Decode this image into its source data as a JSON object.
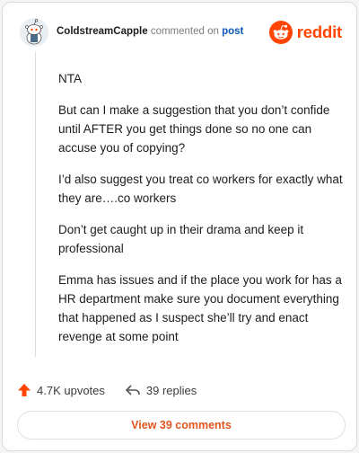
{
  "comment": {
    "username": "ColdstreamCapple",
    "action_text": "commented on",
    "post_link": "post",
    "brand": "reddit",
    "paragraphs": [
      "NTA",
      "But can I make a suggestion that you don’t confide until AFTER you get things done so no one can accuse you of copying?",
      "I’d also suggest you treat co workers for exactly what they are….co workers",
      "Don’t get caught up in their drama and keep it professional",
      "Emma has issues and if the place you work for has a HR department make sure you document everything that happened as I suspect she’ll try and enact revenge at some point"
    ]
  },
  "footer": {
    "upvotes": "4.7K upvotes",
    "replies": "39 replies",
    "view_comments": "View 39 comments"
  },
  "colors": {
    "brand_orange": "#ff4500",
    "link_blue": "#0a58b8",
    "button_text": "#e0561f"
  },
  "icons": [
    "avatar-snoo-icon",
    "reddit-logo-icon",
    "upvote-arrow-icon",
    "reply-arrow-icon"
  ]
}
